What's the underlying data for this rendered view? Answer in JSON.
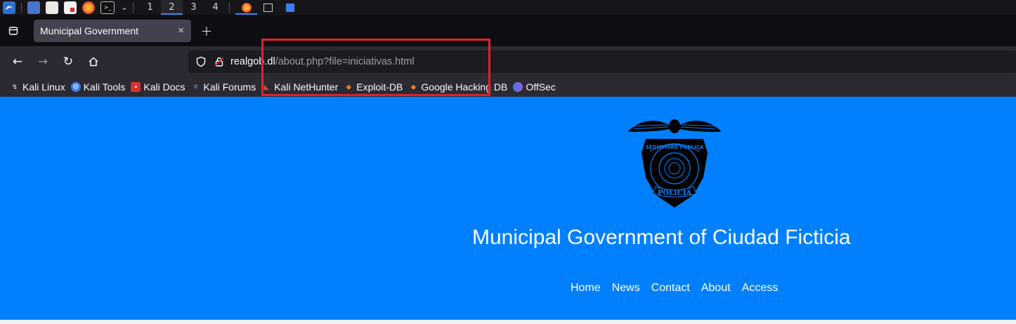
{
  "taskbar": {
    "workspaces": [
      "1",
      "2",
      "3",
      "4"
    ],
    "active_workspace": "2"
  },
  "browser": {
    "tab": {
      "title": "Municipal Government",
      "close_glyph": "×"
    },
    "new_tab_glyph": "+",
    "url": {
      "host": "realgob.dl",
      "path": "/about.php?file=iniciativas.html"
    },
    "bookmarks": [
      {
        "label": "Kali Linux",
        "icon": "kali-dragon-icon"
      },
      {
        "label": "Kali Tools",
        "icon": "kali-tools-icon"
      },
      {
        "label": "Kali Docs",
        "icon": "kali-docs-icon"
      },
      {
        "label": "Kali Forums",
        "icon": "kali-forums-icon"
      },
      {
        "label": "Kali NetHunter",
        "icon": "nethunter-icon"
      },
      {
        "label": "Exploit-DB",
        "icon": "exploit-db-icon"
      },
      {
        "label": "Google Hacking DB",
        "icon": "ghdb-icon"
      },
      {
        "label": "OffSec",
        "icon": "offsec-icon"
      }
    ]
  },
  "page": {
    "logo_text": "SEGURIDAD PUBLICA · POLICIA",
    "title": "Municipal Government of Ciudad Ficticia",
    "nav": [
      "Home",
      "News",
      "Contact",
      "About",
      "Access"
    ],
    "background_color": "#0080fe"
  },
  "colors": {
    "highlight_box": "#e0232a",
    "accent": "#3d8cf0"
  }
}
